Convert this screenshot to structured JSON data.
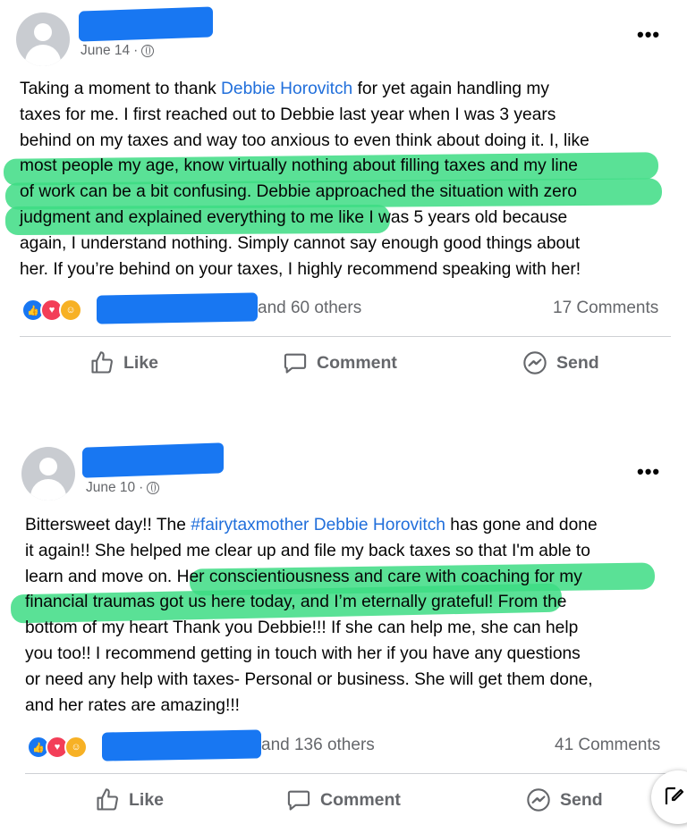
{
  "posts": [
    {
      "date": "June 14",
      "separator": " · ",
      "body": {
        "line1_pre": "Taking a moment to thank ",
        "line1_link": "Debbie Horovitch",
        "line1_post": " for yet again handling my",
        "line2": "taxes for me. I first reached out to Debbie last year when I was 3 years",
        "line3": "behind on my taxes and way too anxious to even think about doing it. I, like",
        "line4": "most people my age, know virtually nothing about filling taxes and my line",
        "line5": "of work can be a bit confusing. Debbie approached the situation with zero",
        "line6": "judgment and explained everything to me like I was 5 years old because",
        "line7": "again, I understand nothing.  Simply cannot say enough good things about",
        "line8": "her. If you’re behind on your taxes, I highly recommend speaking with her!"
      },
      "reactions_others": "and 60 others",
      "comments": "17 Comments",
      "actions": {
        "like": "Like",
        "comment": "Comment",
        "send": "Send"
      }
    },
    {
      "date": "June 10",
      "separator": " · ",
      "body": {
        "line1_pre": "Bittersweet day!! The ",
        "line1_link": "#fairytaxmother Debbie Horovitch",
        "line1_post": " has gone and done",
        "line2": "it again!! She helped me clear up and file my back taxes so that I'm able to",
        "line3": "learn and move on. Her conscientiousness and care with coaching for my",
        "line4": "financial traumas got us here today, and I’m eternally grateful! From the",
        "line5": "bottom of my heart Thank you Debbie!!! If she can help me, she can  help",
        "line6": "you too!!  I recommend getting in touch with her if you have any questions",
        "line7": "or need any help with taxes- Personal or business. She will get them done,",
        "line8": "and her rates are amazing!!!"
      },
      "reactions_others": "and 136 others",
      "comments": "41 Comments",
      "actions": {
        "like": "Like",
        "comment": "Comment",
        "send": "Send"
      }
    }
  ],
  "icons": [
    "like-icon",
    "comment-icon",
    "messenger-icon",
    "globe-icon",
    "more-icon",
    "edit-icon"
  ],
  "colors": {
    "accent": "#1877f2",
    "highlight": "#3ddc84",
    "link": "#216fdb",
    "muted": "#65676b"
  }
}
